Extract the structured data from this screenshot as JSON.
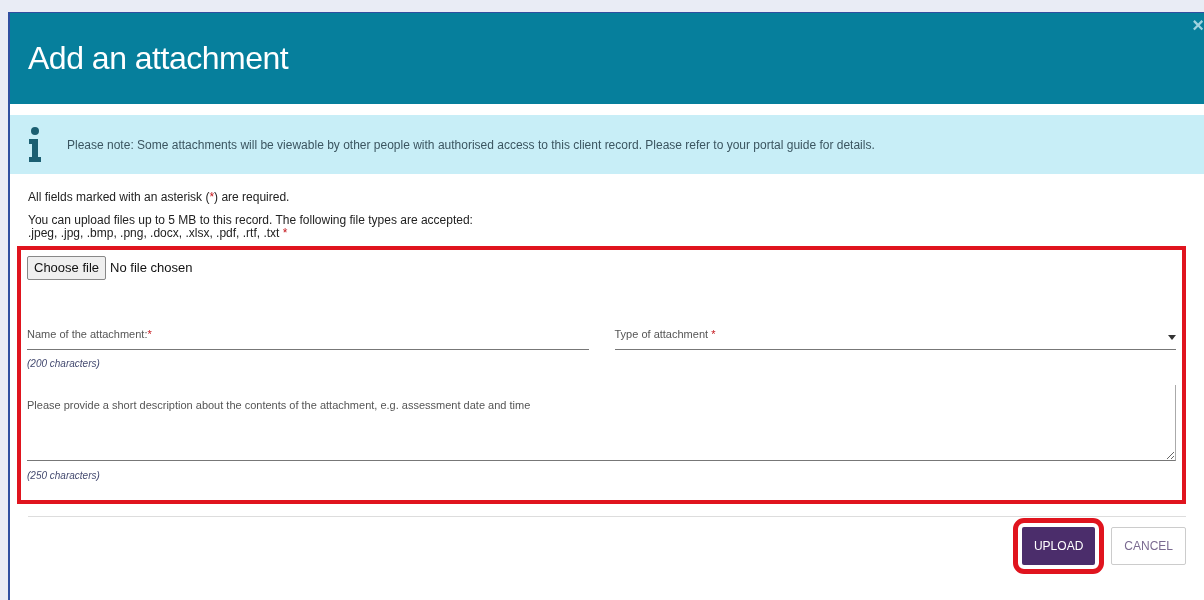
{
  "dialog": {
    "title": "Add an attachment",
    "close": "×"
  },
  "notice": {
    "text": "Please note: Some attachments will be viewable by other people with authorised access to this client record. Please refer to your portal guide for details."
  },
  "required_note": {
    "before": "All fields marked with an asterisk (",
    "mark": "*",
    "after": ") are required."
  },
  "upload_info": {
    "line_1": "You can upload files up to 5 MB to this record. The following file types are accepted:",
    "line_2": ".jpeg, .jpg, .bmp, .png, .docx, .xlsx, .pdf, .rtf, .txt",
    "mark": "*"
  },
  "file_input": {
    "button": "Choose file",
    "status": "No file chosen"
  },
  "name_field": {
    "label": "Name of the attachment:",
    "mark": "*",
    "hint": "(200 characters)"
  },
  "type_field": {
    "label": "Type of attachment",
    "mark": "*"
  },
  "description_field": {
    "placeholder": "Please provide a short description about the contents of the attachment, e.g. assessment date and time",
    "hint": "(250 characters)"
  },
  "buttons": [
    {
      "label": "UPLOAD",
      "kind": "primary"
    },
    {
      "label": "CANCEL",
      "kind": "secondary"
    }
  ]
}
